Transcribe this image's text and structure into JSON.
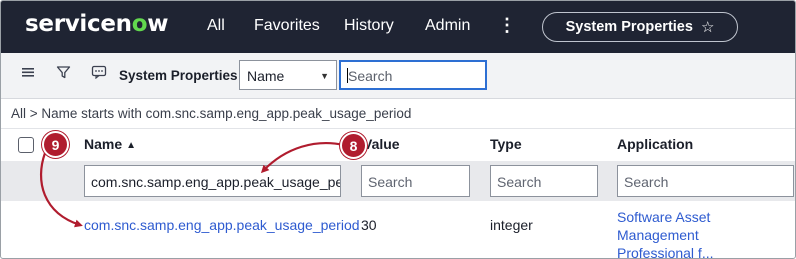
{
  "nav": {
    "logo": "servicenow",
    "items": [
      "All",
      "Favorites",
      "History",
      "Admin"
    ],
    "more": "⋮",
    "pill_label": "System Properties",
    "pill_icon": "star-outline-icon"
  },
  "toolbar": {
    "title": "System Properties",
    "field_select": "Name",
    "search_placeholder": "Search"
  },
  "breadcrumb": "All > Name starts with com.snc.samp.eng_app.peak_usage_period",
  "columns": [
    "Name",
    "Value",
    "Type",
    "Application"
  ],
  "filter_row": {
    "name_value": "com.snc.samp.eng_app.peak_usage_peri",
    "placeholder": "Search"
  },
  "row": {
    "name": "com.snc.samp.eng_app.peak_usage_period",
    "value": "30",
    "type": "integer",
    "application_line1": "Software Asset Management",
    "application_line2": "Professional f..."
  },
  "callouts": {
    "step8": "8",
    "step9": "9",
    "color": "#b01c2e"
  }
}
